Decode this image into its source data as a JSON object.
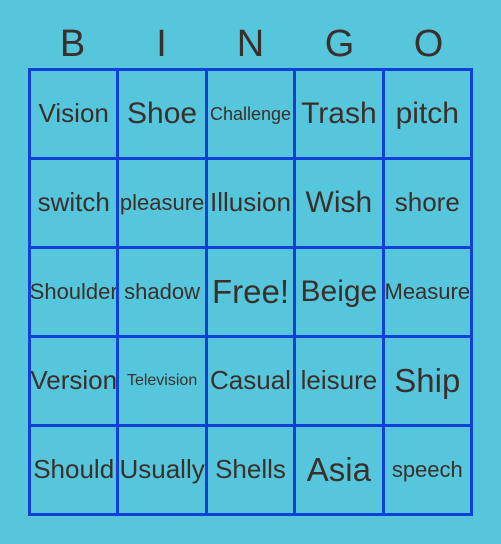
{
  "card": {
    "title_letters": [
      "B",
      "I",
      "N",
      "G",
      "O"
    ],
    "colors": {
      "background": "#55c6dc",
      "grid_line": "#1040d8",
      "text": "#3b2f2c"
    },
    "rows": [
      [
        {
          "label": "Vision",
          "size": "s-l"
        },
        {
          "label": "Shoe",
          "size": "s-xl"
        },
        {
          "label": "Challenge",
          "size": "s-s"
        },
        {
          "label": "Trash",
          "size": "s-xl"
        },
        {
          "label": "pitch",
          "size": "s-xl"
        }
      ],
      [
        {
          "label": "switch",
          "size": "s-l"
        },
        {
          "label": "pleasure",
          "size": "s-m"
        },
        {
          "label": "Illusion",
          "size": "s-l"
        },
        {
          "label": "Wish",
          "size": "s-xl"
        },
        {
          "label": "shore",
          "size": "s-l"
        }
      ],
      [
        {
          "label": "Shoulder",
          "size": "s-m"
        },
        {
          "label": "shadow",
          "size": "s-m"
        },
        {
          "label": "Free!",
          "size": "s-xxl"
        },
        {
          "label": "Beige",
          "size": "s-xl"
        },
        {
          "label": "Measure",
          "size": "s-m"
        }
      ],
      [
        {
          "label": "Version",
          "size": "s-l"
        },
        {
          "label": "Television",
          "size": "s-xs"
        },
        {
          "label": "Casual",
          "size": "s-l"
        },
        {
          "label": "leisure",
          "size": "s-l"
        },
        {
          "label": "Ship",
          "size": "s-xxl"
        }
      ],
      [
        {
          "label": "Should",
          "size": "s-l"
        },
        {
          "label": "Usually",
          "size": "s-l"
        },
        {
          "label": "Shells",
          "size": "s-l"
        },
        {
          "label": "Asia",
          "size": "s-xxl"
        },
        {
          "label": "speech",
          "size": "s-m"
        }
      ]
    ]
  }
}
